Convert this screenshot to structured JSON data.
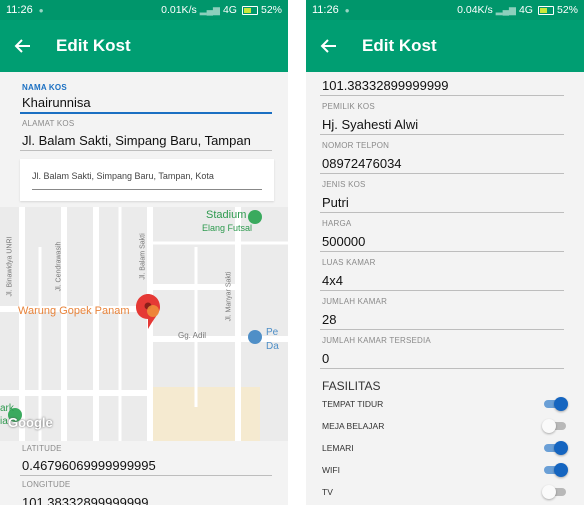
{
  "colors": {
    "statusbar": "#00966b",
    "appbar": "#009e72",
    "accent": "#1a6fc2",
    "switch_on": "#1565c0"
  },
  "left": {
    "status": {
      "time": "11:26",
      "speed": "0.01K/s",
      "network": "4G",
      "battery": "52%"
    },
    "appbar": {
      "title": "Edit Kost"
    },
    "fields": {
      "nama_label": "NAMA KOS",
      "nama_value": "Khairunnisa",
      "alamat_label": "ALAMAT KOS",
      "alamat_value": "Jl. Balam Sakti, Simpang Baru, Tampan",
      "search_value": "Jl. Balam Sakti, Simpang Baru, Tampan, Kota",
      "latitude_label": "LATITUDE",
      "latitude_value": "0.46796069999999995",
      "longitude_label": "LONGITUDE",
      "longitude_value": "101.38332899999999"
    },
    "map": {
      "labels": {
        "stadium": "Stadium",
        "elang": "Elang Futsal",
        "binawidya": "Jl. Binawidya UNRI",
        "cendrawasih": "Jl. Cendrawasih",
        "balam": "Jl. Balam Sakti",
        "manyar": "Jl. Manyar Sakti",
        "warung": "Warung Gopek Panam",
        "adil": "Gg. Adil",
        "pe": "Pe",
        "da": "Da",
        "ark": "ark",
        "google": "Google",
        "ia": "ia"
      }
    }
  },
  "right": {
    "status": {
      "time": "11:26",
      "speed": "0.04K/s",
      "network": "4G",
      "battery": "52%"
    },
    "appbar": {
      "title": "Edit Kost"
    },
    "fields": {
      "longitude_value": "101.38332899999999",
      "pemilik_label": "PEMILIK KOS",
      "pemilik_value": "Hj. Syahesti Alwi",
      "telpon_label": "NOMOR TELPON",
      "telpon_value": "08972476034",
      "jenis_label": "JENIS KOS",
      "jenis_value": "Putri",
      "harga_label": "HARGA",
      "harga_value": "500000",
      "luas_label": "LUAS KAMAR",
      "luas_value": "4x4",
      "jumlah_label": "JUMLAH KAMAR",
      "jumlah_value": "28",
      "tersedia_label": "JUMLAH KAMAR TERSEDIA",
      "tersedia_value": "0"
    },
    "fasilitas": {
      "title": "FASILITAS",
      "items": [
        {
          "label": "TEMPAT TIDUR",
          "on": true
        },
        {
          "label": "MEJA BELAJAR",
          "on": false
        },
        {
          "label": "LEMARI",
          "on": true
        },
        {
          "label": "WIFI",
          "on": true
        },
        {
          "label": "TV",
          "on": false
        }
      ]
    }
  }
}
